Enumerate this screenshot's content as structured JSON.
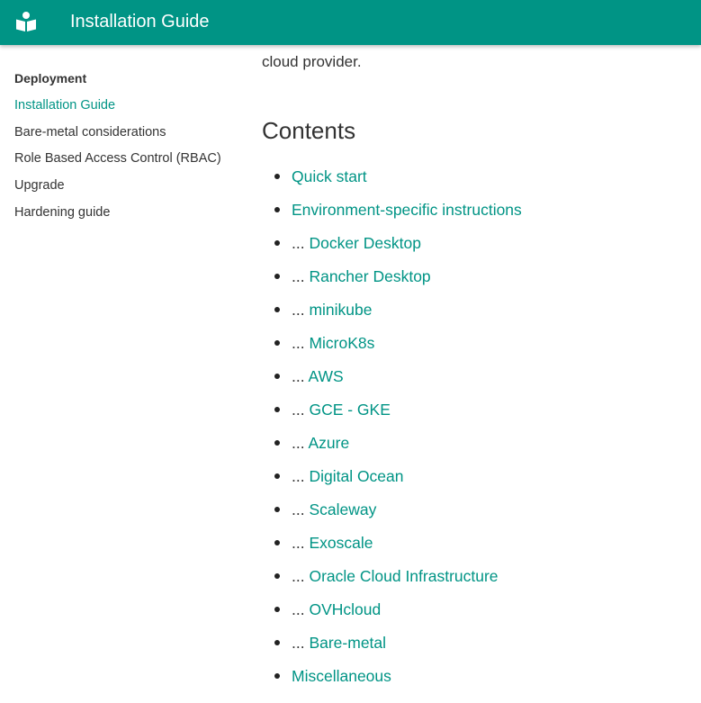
{
  "header": {
    "title": "Installation Guide",
    "brand_color": "#009485",
    "logo_icon": "book-reader-icon"
  },
  "sidebar": {
    "heading": "Deployment",
    "items": [
      {
        "label": "Installation Guide",
        "active": true
      },
      {
        "label": "Bare-metal considerations"
      },
      {
        "label": "Role Based Access Control (RBAC)"
      },
      {
        "label": "Upgrade"
      },
      {
        "label": "Hardening guide"
      }
    ]
  },
  "main": {
    "intro_text": "cloud provider.",
    "contents_title": "Contents",
    "toc": [
      {
        "prefix": "",
        "label": "Quick start"
      },
      {
        "prefix": "",
        "label": "Environment-specific instructions"
      },
      {
        "prefix": "... ",
        "label": "Docker Desktop"
      },
      {
        "prefix": "... ",
        "label": "Rancher Desktop"
      },
      {
        "prefix": "... ",
        "label": "minikube"
      },
      {
        "prefix": "... ",
        "label": "MicroK8s"
      },
      {
        "prefix": "... ",
        "label": "AWS"
      },
      {
        "prefix": "... ",
        "label": "GCE - GKE"
      },
      {
        "prefix": "... ",
        "label": "Azure"
      },
      {
        "prefix": "... ",
        "label": "Digital Ocean"
      },
      {
        "prefix": "... ",
        "label": "Scaleway"
      },
      {
        "prefix": "... ",
        "label": "Exoscale"
      },
      {
        "prefix": "... ",
        "label": "Oracle Cloud Infrastructure"
      },
      {
        "prefix": "... ",
        "label": "OVHcloud"
      },
      {
        "prefix": "... ",
        "label": "Bare-metal"
      },
      {
        "prefix": "",
        "label": "Miscellaneous"
      }
    ]
  }
}
